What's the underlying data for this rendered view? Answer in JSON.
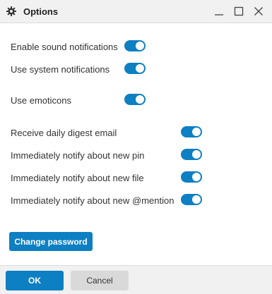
{
  "window": {
    "title": "Options",
    "icon": "gear-icon",
    "controls": [
      "minimize-icon",
      "maximize-icon",
      "close-icon"
    ]
  },
  "settings": {
    "sound_notifications": {
      "label": "Enable sound notifications",
      "enabled": true
    },
    "system_notifications": {
      "label": "Use system notifications",
      "enabled": true
    },
    "emoticons": {
      "label": "Use emoticons",
      "enabled": true
    },
    "daily_digest": {
      "label": "Receive daily digest email",
      "enabled": true
    },
    "notify_pin": {
      "label": "Immediately notify about new pin",
      "enabled": true
    },
    "notify_file": {
      "label": "Immediately notify about new file",
      "enabled": true
    },
    "notify_mention": {
      "label": "Immediately notify about new @mention",
      "enabled": true
    }
  },
  "actions": {
    "change_password": "Change password",
    "ok": "OK",
    "cancel": "Cancel"
  },
  "colors": {
    "accent": "#0d7fc3",
    "titlebar_bg": "#f1f1f1",
    "cancel_bg": "#d9d9d9"
  }
}
